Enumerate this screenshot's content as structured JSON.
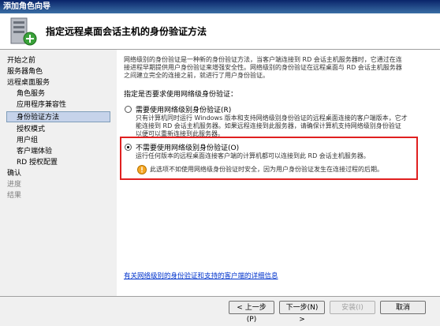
{
  "window": {
    "title": "添加角色向导"
  },
  "header": {
    "title": "指定远程桌面会话主机的身份验证方法"
  },
  "nav": {
    "items": [
      {
        "label": "开始之前",
        "state": "normal"
      },
      {
        "label": "服务器角色",
        "state": "normal"
      },
      {
        "label": "远程桌面服务",
        "state": "normal"
      },
      {
        "label": "角色服务",
        "state": "normal"
      },
      {
        "label": "应用程序兼容性",
        "state": "normal"
      },
      {
        "label": "身份验证方法",
        "state": "selected"
      },
      {
        "label": "授权模式",
        "state": "normal"
      },
      {
        "label": "用户组",
        "state": "normal"
      },
      {
        "label": "客户端体验",
        "state": "normal"
      },
      {
        "label": "RD 授权配置",
        "state": "normal"
      },
      {
        "label": "确认",
        "state": "normal"
      },
      {
        "label": "进度",
        "state": "disabled"
      },
      {
        "label": "结果",
        "state": "disabled"
      }
    ]
  },
  "content": {
    "intro_line1": "网络级别的身份验证是一种新的身份验证方法，当客户端连接到 RD 会话主机服务器时，它通过在连",
    "intro_line2": "接进程早期提供用户身份验证来增强安全性。网络级别的身份验证在远程桌面与 RD 会话主机服务器",
    "intro_line3": "之间建立完全的连接之前，就进行了用户身份验证。",
    "question": "指定是否要求使用网络级身份验证：",
    "option1": {
      "label": "需要使用网络级别身份验证(R)",
      "desc1": "只有计算机同时运行 Windows 版本和支持网络级别身份验证的远程桌面连接的客户端版本，它才",
      "desc2": "能连接到 RD 会话主机服务器。如果远程连接到此服务器，请确保计算机支持网络级别身份验证",
      "desc3": "以便可以重新连接到此服务器。",
      "selected": false
    },
    "option2": {
      "label": "不需要使用网络级别身份验证(O)",
      "desc": "运行任何版本的远程桌面连接客户端的计算机都可以连接到此 RD 会话主机服务器。",
      "warning": "此选项不如使用网络级身份验证时安全，因为用户身份验证发生在连接过程的后期。",
      "selected": true
    },
    "link": "有关网络级别的身份验证和支持的客户端的详细信息"
  },
  "footer": {
    "prev": "< 上一步(P)",
    "next": "下一步(N) >",
    "install": "安装(I)",
    "cancel": "取消"
  }
}
